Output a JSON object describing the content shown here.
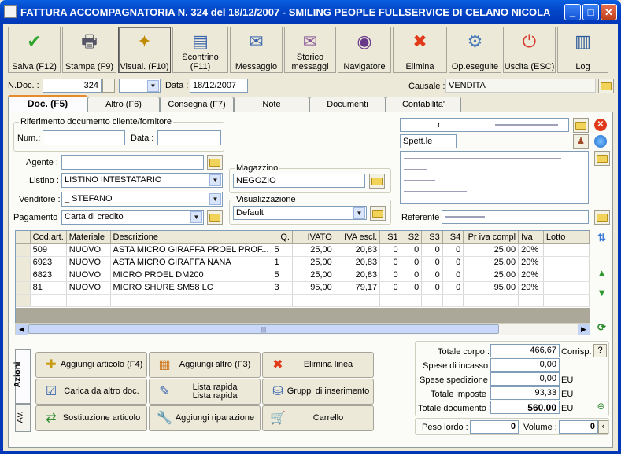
{
  "window": {
    "title": "FATTURA ACCOMPAGNATORIA N. 324  del 18/12/2007 - SMILING PEOPLE FULLSERVICE DI CELANO NICOLA",
    "min": "_",
    "max": "□",
    "close": "✕"
  },
  "toolbar": [
    {
      "label": "Salva (F12)",
      "icon": "check-icon",
      "glyph": "✔",
      "color": "#2ea52e"
    },
    {
      "label": "Stampa (F9)",
      "icon": "printer-icon",
      "glyph": "🖶",
      "color": "#556"
    },
    {
      "label": "Visual. (F10)",
      "icon": "magic-wand-icon",
      "glyph": "✦",
      "color": "#c08a00",
      "selected": true
    },
    {
      "label": "Scontrino\n(F11)",
      "icon": "cash-register-icon",
      "glyph": "▤",
      "color": "#3a66b0"
    },
    {
      "label": "Messaggio",
      "icon": "message-icon",
      "glyph": "✉",
      "color": "#3a66b0"
    },
    {
      "label": "Storico\nmessaggi",
      "icon": "message-history-icon",
      "glyph": "✉",
      "color": "#8a5a9a"
    },
    {
      "label": "Navigatore",
      "icon": "navigator-icon",
      "glyph": "◉",
      "color": "#6a3a8a"
    },
    {
      "label": "Elimina",
      "icon": "delete-icon",
      "glyph": "✖",
      "color": "#e03a1a"
    },
    {
      "label": "Op.eseguite",
      "icon": "gears-icon",
      "glyph": "⚙",
      "color": "#4a7ab8"
    },
    {
      "label": "Uscita (ESC)",
      "icon": "exit-icon",
      "glyph": "⏻",
      "color": "#d83a2a"
    },
    {
      "label": "Log",
      "icon": "log-book-icon",
      "glyph": "▥",
      "color": "#2a5a9a"
    }
  ],
  "header": {
    "ndoc_label": "N.Doc. :",
    "ndoc_value": "324",
    "data_label": "Data :",
    "data_value": "18/12/2007",
    "causale_label": "Causale :",
    "causale_value": "VENDITA"
  },
  "tabs": [
    "Doc. (F5)",
    "Altro (F6)",
    "Consegna (F7)",
    "Note",
    "Documenti",
    "Contabilita'"
  ],
  "riferimento": {
    "title": "Riferimento documento cliente/fornitore",
    "num_label": "Num.:",
    "num_value": "",
    "data_label": "Data :",
    "data_value": ""
  },
  "form": {
    "agente_label": "Agente :",
    "agente_value": "",
    "listino_label": "Listino :",
    "listino_value": "LISTINO INTESTATARIO",
    "venditore_label": "Venditore :",
    "venditore_value": "_    STEFANO",
    "pagamento_label": "Pagamento :",
    "pagamento_value": "Carta di credito",
    "magazzino_title": "Magazzino",
    "magazzino_value": "NEGOZIO",
    "visualizzazione_title": "Visualizzazione",
    "visualizzazione_value": "Default"
  },
  "cliente": {
    "code": "r",
    "spett": "Spett.le",
    "referente_label": "Referente"
  },
  "grid": {
    "columns": [
      "Cod.art.",
      "Materiale",
      "Descrizione",
      "Q.",
      "IVATO",
      "IVA escl.",
      "S1",
      "S2",
      "S3",
      "S4",
      "Pr iva compl",
      "Iva",
      "Lotto"
    ],
    "rows": [
      [
        "509",
        "NUOVO",
        "ASTA MICRO GIRAFFA PROEL PROF...",
        "5",
        "25,00",
        "20,83",
        "0",
        "0",
        "0",
        "0",
        "25,00",
        "20%",
        ""
      ],
      [
        "6923",
        "NUOVO",
        "ASTA MICRO GIRAFFA NANA",
        "1",
        "25,00",
        "20,83",
        "0",
        "0",
        "0",
        "0",
        "25,00",
        "20%",
        ""
      ],
      [
        "6823",
        "NUOVO",
        "MICRO PROEL DM200",
        "5",
        "25,00",
        "20,83",
        "0",
        "0",
        "0",
        "0",
        "25,00",
        "20%",
        ""
      ],
      [
        "81",
        "NUOVO",
        "MICRO SHURE SM58 LC",
        "3",
        "95,00",
        "79,17",
        "0",
        "0",
        "0",
        "0",
        "95,00",
        "20%",
        ""
      ]
    ],
    "hscroll_mark": "|||"
  },
  "side_tabs": [
    "Azioni",
    "Av."
  ],
  "actions": [
    {
      "label": "Aggiungi articolo (F4)",
      "icon": "add-article-icon",
      "glyph": "✚",
      "color": "#c89a10"
    },
    {
      "label": "Aggiungi altro (F3)",
      "icon": "add-other-icon",
      "glyph": "▦",
      "color": "#d07a20"
    },
    {
      "label": "Elimina linea",
      "icon": "delete-line-icon",
      "glyph": "✖",
      "color": "#e03a1a"
    },
    {
      "label": "Carica da altro doc.",
      "icon": "load-doc-icon",
      "glyph": "☑",
      "color": "#3a66b0"
    },
    {
      "label": "Lista rapida\nLista rapida",
      "icon": "quick-list-icon",
      "glyph": "✎",
      "color": "#3a66b0"
    },
    {
      "label": "Gruppi di inserimento",
      "icon": "insert-groups-icon",
      "glyph": "⛁",
      "color": "#3a66b0"
    },
    {
      "label": "Sostituzione articolo",
      "icon": "replace-article-icon",
      "glyph": "⇄",
      "color": "#2e8a2e"
    },
    {
      "label": "Aggiungi riparazione",
      "icon": "wrench-icon",
      "glyph": "🔧",
      "color": "#667"
    },
    {
      "label": "Carrello",
      "icon": "cart-icon",
      "glyph": "🛒",
      "color": "#2e8a2e"
    }
  ],
  "totals": {
    "totale_corpo_label": "Totale corpo :",
    "totale_corpo": "466,67",
    "corrisp": "Corrisp.",
    "help": "?",
    "spese_incasso_label": "Spese di incasso :",
    "spese_incasso": "0,00",
    "spese_spedizione_label": "Spese spedizione :",
    "spese_spedizione": "0,00",
    "eur1": "EU",
    "totale_imposte_label": "Totale imposte :",
    "totale_imposte": "93,33",
    "eur2": "EU",
    "totale_documento_label": "Totale documento :",
    "totale_documento": "560,00",
    "eur3": "EU",
    "peso_label": "Peso lordo :",
    "peso": "0",
    "volume_label": "Volume :",
    "volume": "0"
  }
}
